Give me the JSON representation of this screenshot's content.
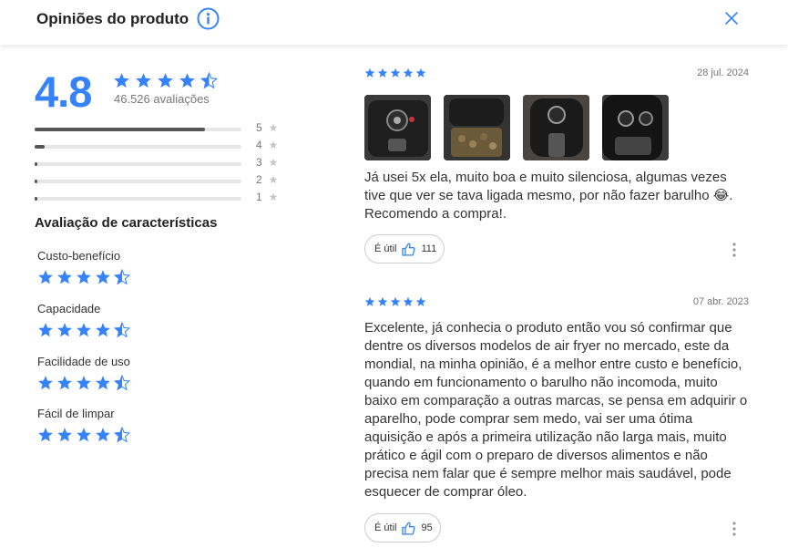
{
  "header": {
    "title": "Opiniões do produto",
    "info_icon": "info-circle-icon",
    "close_icon": "close-icon"
  },
  "colors": {
    "accent": "#3483fa",
    "bar": "#555555",
    "track": "#e6e6e6"
  },
  "summary": {
    "average": "4.8",
    "count_text": "46.526 avaliações",
    "stars": 4.8
  },
  "distribution": [
    {
      "label": "5",
      "fraction": 0.91
    },
    {
      "label": "4",
      "fraction": 0.055
    },
    {
      "label": "3",
      "fraction": 0.012
    },
    {
      "label": "2",
      "fraction": 0.006
    },
    {
      "label": "1",
      "fraction": 0.014
    }
  ],
  "characteristics": {
    "title": "Avaliação de características",
    "items": [
      {
        "label": "Custo-benefício",
        "rating": 4.5
      },
      {
        "label": "Capacidade",
        "rating": 4.5
      },
      {
        "label": "Facilidade de uso",
        "rating": 4.5
      },
      {
        "label": "Fácil de limpar",
        "rating": 4.5
      }
    ]
  },
  "reviews": [
    {
      "rating": 5,
      "date": "28 jul. 2024",
      "photos": 4,
      "text": "Já usei 5x ela, muito boa e muito silenciosa, algumas vezes tive que ver se tava ligada mesmo, por não fazer barulho 😂. Recomendo a compra!.",
      "useful_label": "É útil",
      "useful_count": "111"
    },
    {
      "rating": 5,
      "date": "07 abr. 2023",
      "photos": 0,
      "text": "Excelente, já conhecia o produto então vou só confirmar que dentre os diversos modelos de air fryer no mercado, este da mondial, na minha opinião, é a melhor entre custo e benefício, quando em funcionamento o barulho não incomoda, muito baixo em comparação a outras marcas, se pensa em adquirir o aparelho, pode comprar sem medo, vai ser uma ótima aquisição e após a primeira utilização não larga mais, muito prático e ágil com o preparo de diversos alimentos e não precisa nem falar que é sempre melhor mais saudável, pode esquecer de comprar óleo.",
      "useful_label": "É útil",
      "useful_count": "95"
    }
  ]
}
